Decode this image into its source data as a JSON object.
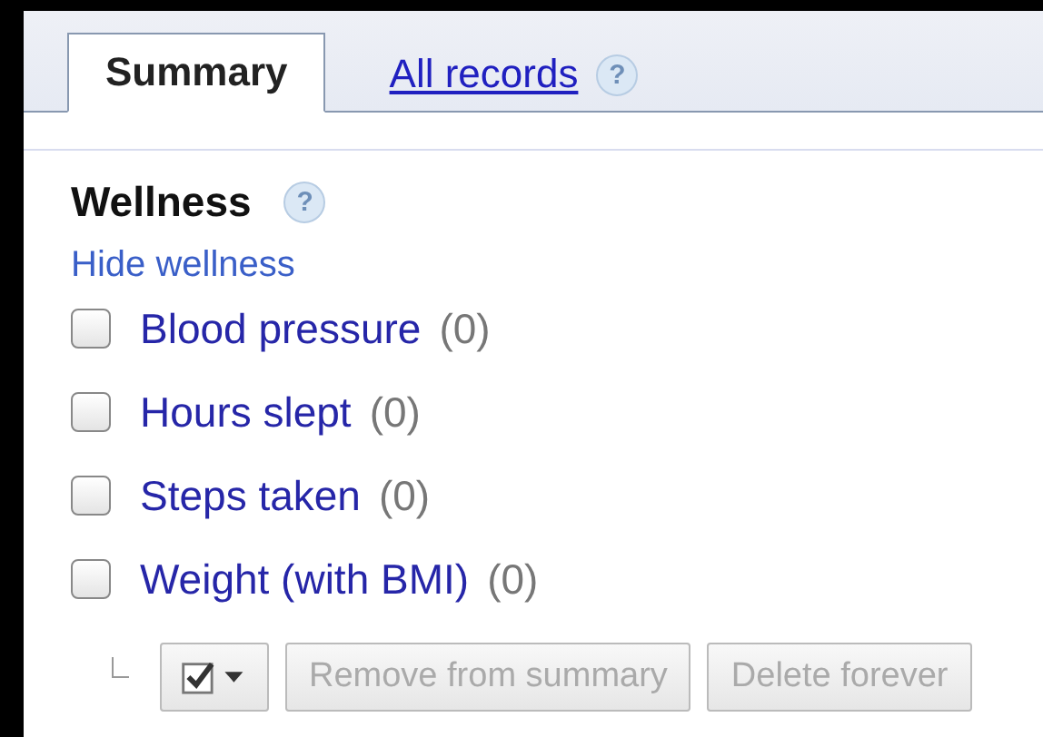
{
  "tabs": [
    {
      "label": "Summary",
      "selected": true
    },
    {
      "label": "All records",
      "selected": false,
      "help": "?"
    }
  ],
  "section": {
    "title": "Wellness",
    "help": "?",
    "toggle": "Hide wellness"
  },
  "items": [
    {
      "label": "Blood pressure",
      "count": "(0)",
      "checked": false
    },
    {
      "label": "Hours slept",
      "count": "(0)",
      "checked": false
    },
    {
      "label": "Steps taken",
      "count": "(0)",
      "checked": false
    },
    {
      "label": "Weight (with BMI)",
      "count": "(0)",
      "checked": false
    }
  ],
  "actions": [
    {
      "label": "Remove from summary",
      "disabled": true
    },
    {
      "label": "Delete forever",
      "disabled": true
    }
  ]
}
